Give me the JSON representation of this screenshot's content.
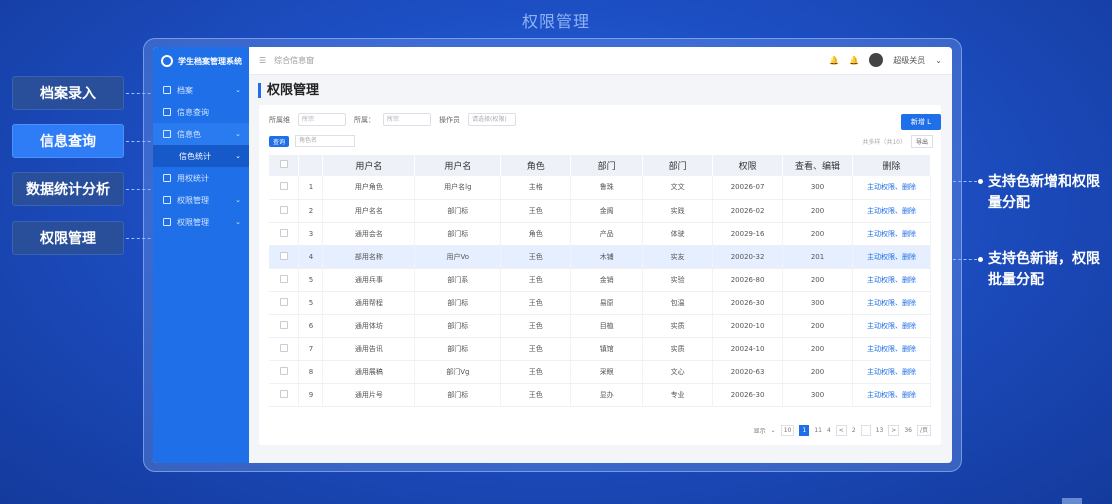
{
  "header_title": "权限管理",
  "callouts_left": [
    "档案录入",
    "信息查询",
    "数据统计分析",
    "权限管理"
  ],
  "callouts_right": [
    "支持色新增和权限量分配",
    "支持色新谐，权限批量分配"
  ],
  "app": {
    "logo_text": "学生档案管理系统",
    "breadcrumb": "综合信息窗",
    "user_name": "超级关员"
  },
  "sidebar": {
    "items": [
      {
        "label": "档案"
      },
      {
        "label": "信息查询"
      },
      {
        "label": "信息色"
      },
      {
        "label": "信色统计"
      },
      {
        "label": "用权统计"
      },
      {
        "label": "权限管理"
      },
      {
        "label": "权限管理"
      }
    ]
  },
  "page": {
    "title": "权限管理",
    "filters": [
      {
        "label": "所属维",
        "placeholder": "所宗"
      },
      {
        "label": "所属：",
        "placeholder": "所宗"
      },
      {
        "label": "操作员",
        "placeholder": "请选择(权限)"
      }
    ],
    "add_button": "新增 L",
    "tag": "查询",
    "search_placeholder": "角色名",
    "right_info": "共多样（共10）",
    "export_button": "导出"
  },
  "table": {
    "headers": [
      "",
      "",
      "用户名",
      "用户名",
      "角色",
      "部门",
      "部门",
      "权限",
      "查看、编辑",
      "删除"
    ],
    "rows": [
      {
        "num": "1",
        "c1": "用户角色",
        "c2": "用户名lg",
        "role": "主格",
        "d1": "鲁珠",
        "d2": "文文",
        "date": "20026-07",
        "n": "300",
        "a": "主动权限、",
        "b": "删除"
      },
      {
        "num": "2",
        "c1": "用户名名",
        "c2": "部门标",
        "role": "王色",
        "d1": "金阁",
        "d2": "实践",
        "date": "20026-02",
        "n": "200",
        "a": "主动权限、",
        "b": "删除"
      },
      {
        "num": "3",
        "c1": "通用会名",
        "c2": "部门标",
        "role": "角色",
        "d1": "产品",
        "d2": "体驶",
        "date": "20029-16",
        "n": "200",
        "a": "主动权限、",
        "b": "删除"
      },
      {
        "num": "4",
        "c1": "部用名称",
        "c2": "用户Vo",
        "role": "王色",
        "d1": "木铺",
        "d2": "实友",
        "date": "20020-32",
        "n": "201",
        "a": "主动权限、",
        "b": "删除"
      },
      {
        "num": "5",
        "c1": "通用兵事",
        "c2": "部门系",
        "role": "王色",
        "d1": "金销",
        "d2": "实验",
        "date": "20026-80",
        "n": "200",
        "a": "主动权限、",
        "b": "删除"
      },
      {
        "num": "5",
        "c1": "通用帮程",
        "c2": "部门标",
        "role": "王色",
        "d1": "易原",
        "d2": "包温",
        "date": "20026-30",
        "n": "300",
        "a": "主动权限、",
        "b": "删除"
      },
      {
        "num": "6",
        "c1": "通用体坊",
        "c2": "部门标",
        "role": "王色",
        "d1": "目植",
        "d2": "实质",
        "date": "20020-10",
        "n": "200",
        "a": "主动权限、",
        "b": "删除"
      },
      {
        "num": "7",
        "c1": "通用告讯",
        "c2": "部门标",
        "role": "王色",
        "d1": "镇馆",
        "d2": "实质",
        "date": "20024-10",
        "n": "200",
        "a": "主动权限、",
        "b": "删除"
      },
      {
        "num": "8",
        "c1": "通用展稿",
        "c2": "部门Vg",
        "role": "王色",
        "d1": "采眼",
        "d2": "文心",
        "date": "20020-63",
        "n": "200",
        "a": "主动权限、",
        "b": "删除"
      },
      {
        "num": "9",
        "c1": "通用片号",
        "c2": "部门标",
        "role": "王色",
        "d1": "显办",
        "d2": "专业",
        "date": "20026-30",
        "n": "300",
        "a": "主动权限、",
        "b": "删除"
      }
    ]
  },
  "pager": {
    "label": "显示",
    "pages": [
      "10",
      "1",
      "11",
      "4",
      "<",
      "2",
      "",
      "13",
      ">",
      "36"
    ],
    "active": "1",
    "tail": "/页"
  }
}
